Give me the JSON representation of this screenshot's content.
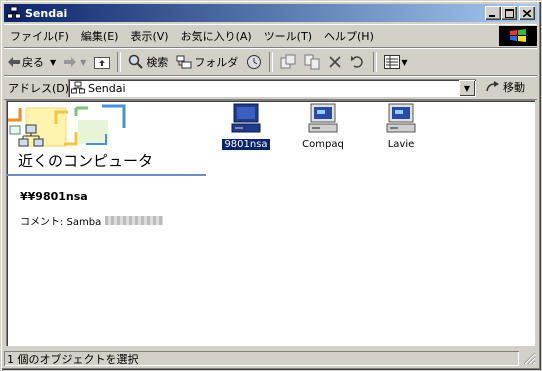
{
  "window": {
    "title": "Sendai"
  },
  "menu": [
    "ファイル(F)",
    "編集(E)",
    "表示(V)",
    "お気に入り(A)",
    "ツール(T)",
    "ヘルプ(H)"
  ],
  "toolbar": {
    "back": "戻る",
    "search": "検索",
    "folders": "フォルダ"
  },
  "address": {
    "label": "アドレス(D)",
    "value": "Sendai",
    "go": "移動"
  },
  "panel": {
    "title": "近くのコンピュータ",
    "unc": "¥¥9801nsa",
    "comment": "コメント: Samba"
  },
  "items": [
    {
      "label": "9801nsa",
      "selected": true
    },
    {
      "label": "Compaq",
      "selected": false
    },
    {
      "label": "Lavie",
      "selected": false
    }
  ],
  "status": {
    "text": "1 個のオブジェクトを選択"
  }
}
